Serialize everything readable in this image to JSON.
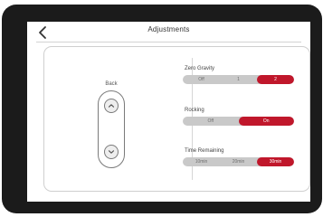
{
  "app": {
    "title": "Adjustments",
    "accent_color": "#c0172b",
    "inactive_color": "#c9c9c9"
  },
  "left": {
    "label": "Back",
    "up_icon": "chevron-up-icon",
    "down_icon": "chevron-down-icon"
  },
  "zero_gravity": {
    "label": "Zero Gravity",
    "options": [
      "Off",
      "1",
      "2"
    ],
    "selected_index": 2
  },
  "rocking": {
    "label": "Rocking",
    "options": [
      "Off",
      "On"
    ],
    "selected_index": 1
  },
  "time_remaining": {
    "label": "Time Remaining",
    "options": [
      "10min",
      "20min",
      "30min"
    ],
    "selected_index": 2
  }
}
